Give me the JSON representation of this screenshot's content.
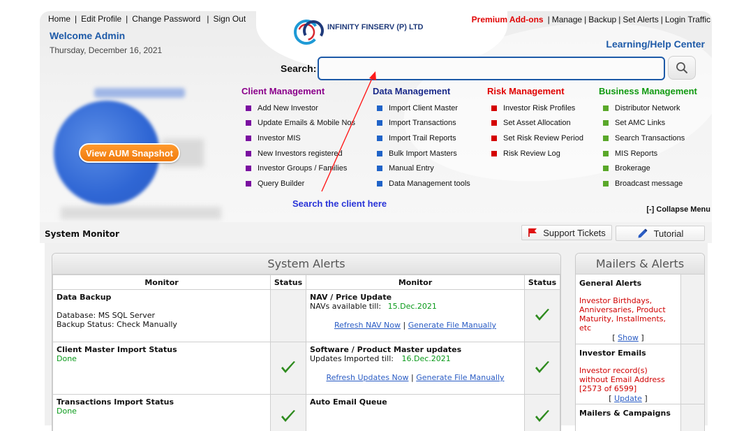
{
  "top_nav": {
    "home": "Home",
    "edit_profile": "Edit Profile",
    "change_password": "Change Password",
    "sign_out": "Sign Out",
    "separator": "|"
  },
  "welcome": "Welcome Admin",
  "date": "Thursday, December 16, 2021",
  "logo": {
    "mark": "OC",
    "name": "INFINITY FINSERV (P) LTD"
  },
  "right_nav": {
    "premium": "Premium Add-ons",
    "manage": "Manage",
    "backup": "Backup",
    "set_alerts": "Set Alerts",
    "login_traffic": "Login Traffic",
    "separator": "|"
  },
  "help_center": "Learning/Help Center",
  "search": {
    "label": "Search:",
    "value": "",
    "button_icon": "search-icon"
  },
  "aum_button": "View AUM Snapshot",
  "menus": [
    {
      "title": "Client Management",
      "color": "#8b008b",
      "square": "#7a0fa0",
      "items": [
        "Add New Investor",
        "Update Emails & Mobile Nos",
        "Investor MIS",
        "New Investors registered",
        "Investor Groups / Families",
        "Query Builder"
      ]
    },
    {
      "title": "Data Management",
      "color": "#1a2a8a",
      "square": "#1f63c8",
      "items": [
        "Import Client Master",
        "Import Transactions",
        "Import Trail Reports",
        "Bulk Import Masters",
        "Manual Entry",
        "Data Management tools"
      ]
    },
    {
      "title": "Risk Management",
      "color": "#e00000",
      "square": "#d40000",
      "items": [
        "Investor Risk Profiles",
        "Set Asset Allocation",
        "Set Risk Review Period",
        "Risk Review Log"
      ]
    },
    {
      "title": "Business Management",
      "color": "#119a11",
      "square": "#5aa82a",
      "items": [
        "Distributor Network",
        "Set AMC Links",
        "Search Transactions",
        "MIS Reports",
        "Brokerage",
        "Broadcast message"
      ]
    }
  ],
  "search_hint": "Search the client here",
  "collapse_menu": "[-] Collapse Menu",
  "system_monitor": "System Monitor",
  "support_tickets": "Support Tickets",
  "tutorial": "Tutorial",
  "system_alerts": {
    "title": "System Alerts",
    "headers": {
      "monitor": "Monitor",
      "status": "Status"
    },
    "data_backup": {
      "title": "Data Backup",
      "database": "Database: MS SQL Server",
      "backup_status": "Backup Status: Check Manually"
    },
    "nav_price": {
      "title": "NAV / Price Update",
      "label": "NAVs available till:",
      "date": "15.Dec.2021",
      "link1": "Refresh NAV Now",
      "link2": "Generate File Manually",
      "separator": "|"
    },
    "client_master": {
      "title": "Client Master Import Status",
      "status": "Done"
    },
    "software_master": {
      "title": "Software / Product Master updates",
      "label": "Updates Imported till:",
      "date": "16.Dec.2021",
      "link1": "Refresh Updates Now",
      "link2": "Generate File Manually",
      "separator": "|"
    },
    "transactions": {
      "title": "Transactions Import Status",
      "status": "Done"
    },
    "auto_email": {
      "title": "Auto Email Queue"
    }
  },
  "mailers": {
    "title": "Mailers & Alerts",
    "general": {
      "title": "General Alerts",
      "text": "Investor Birthdays, Anniversaries, Product Maturity, Installments, etc",
      "link_open": "[",
      "link": "Show",
      "link_close": "]"
    },
    "emails": {
      "title": "Investor Emails",
      "text": "Investor record(s) without Email Address [2573 of 6599]",
      "link_open": "[",
      "link": "Update",
      "link_close": "]"
    },
    "campaigns": {
      "title": "Mailers & Campaigns"
    }
  },
  "colors": {
    "accent_blue": "#1d5aa8",
    "premium_red": "#e00000",
    "done_green": "#0a9a1a",
    "aum_orange": "#f07b0c",
    "hint_blue": "#2a35d8"
  }
}
